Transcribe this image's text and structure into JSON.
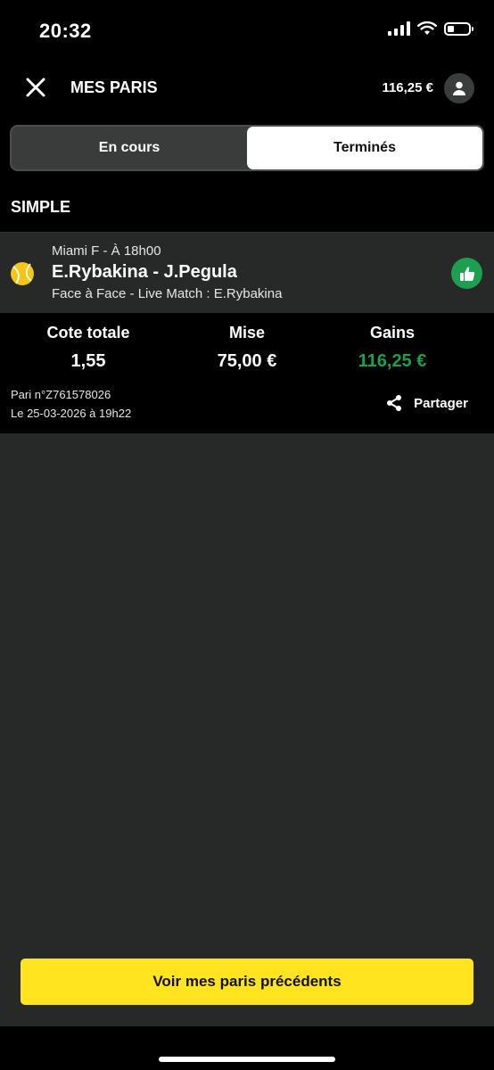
{
  "status_bar": {
    "time": "20:32"
  },
  "header": {
    "title": "MES PARIS",
    "balance": "116,25 €"
  },
  "tabs": [
    {
      "label": "En cours",
      "active": false
    },
    {
      "label": "Terminés",
      "active": true
    }
  ],
  "section": {
    "label": "SIMPLE"
  },
  "bet": {
    "meta": "Miami F - À 18h00",
    "match": "E.Rybakina - J.Pegula",
    "selection": "Face à Face - Live Match : E.Rybakina",
    "sport_icon": "tennis-ball-icon",
    "status_icon": "thumbs-up-icon"
  },
  "summary": {
    "cote_label": "Cote totale",
    "cote_value": "1,55",
    "mise_label": "Mise",
    "mise_value": "75,00 €",
    "gains_label": "Gains",
    "gains_value": "116,25 €",
    "bet_id": "Pari n°Z761578026",
    "bet_date": "Le 25-03-2026 à 19h22",
    "share_label": "Partager"
  },
  "cta": {
    "label": "Voir mes paris précédents"
  },
  "colors": {
    "accent_yellow": "#ffe41f",
    "win_green": "#1e9e4f",
    "background": "#262927",
    "header_bg": "#000000"
  }
}
